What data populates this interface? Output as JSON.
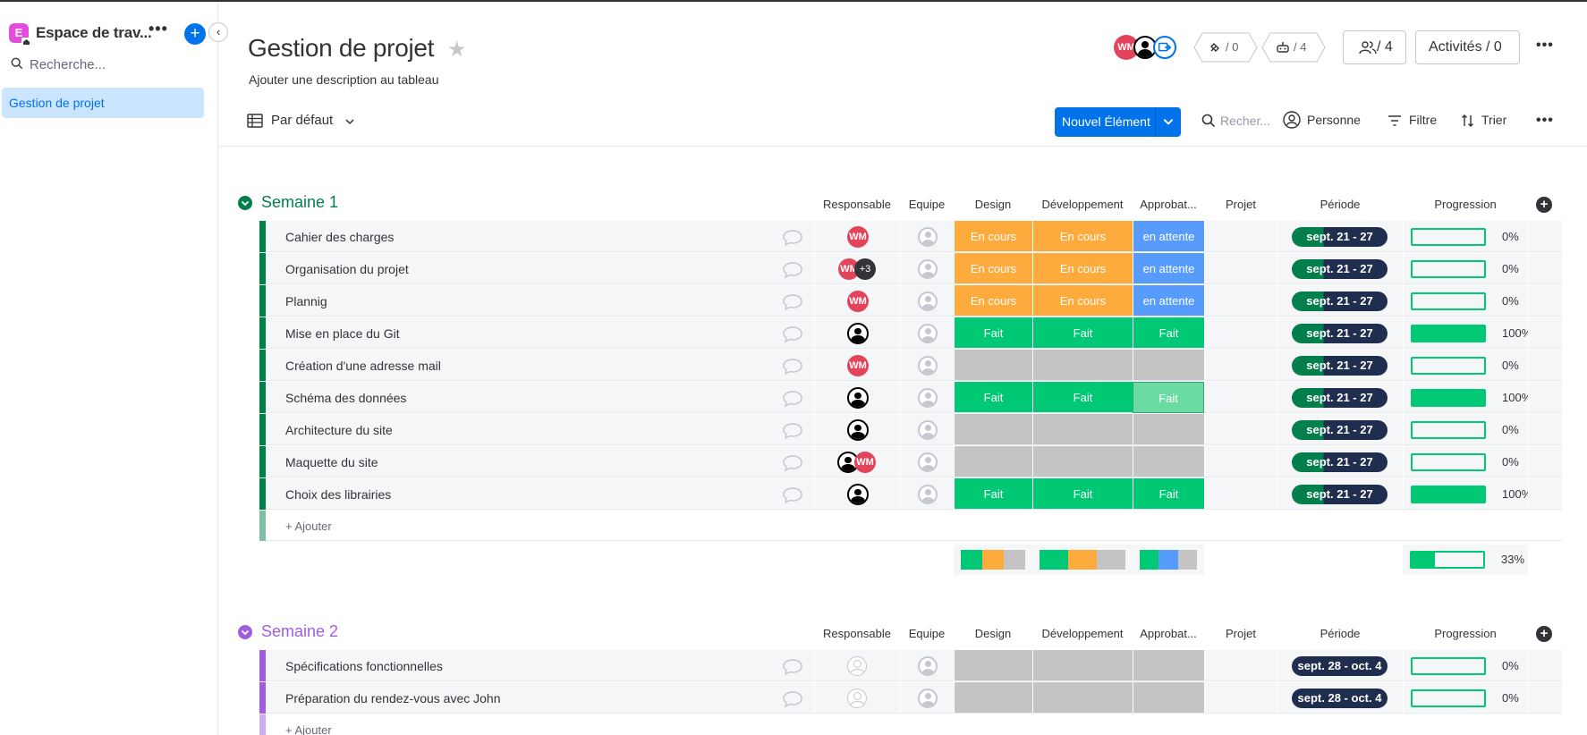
{
  "sidebar": {
    "workspace_initial": "E",
    "workspace_title": "Espace de trav...",
    "dots": "•••",
    "add": "+",
    "collapse": "‹",
    "search_placeholder": "Recherche...",
    "items": [
      {
        "label": "Gestion de projet",
        "active": true
      }
    ]
  },
  "header": {
    "title": "Gestion de projet",
    "description": "Ajouter une description au tableau",
    "avatars": [
      "WM"
    ],
    "integrations": "/ 0",
    "automations": "/ 4",
    "members": "/ 4",
    "activities": "Activités / 0",
    "more": "•••"
  },
  "toolbar": {
    "view": "Par défaut",
    "new_item": "Nouvel Élément",
    "search": "Recher...",
    "person": "Personne",
    "filter": "Filtre",
    "sort": "Trier",
    "more": "•••"
  },
  "columns": [
    "Responsable",
    "Equipe",
    "Design",
    "Développement",
    "Approbat...",
    "Projet",
    "Période",
    "Progression"
  ],
  "colors": {
    "green": "#00c875",
    "orange": "#fdab3d",
    "blue": "#579bfc",
    "grey": "#c4c4c4",
    "navy": "#1f2d4e",
    "group1": "#037f4c",
    "group2": "#a25ddc"
  },
  "groups": [
    {
      "name": "Semaine 1",
      "color": "#037f4c",
      "add_label": "+ Ajouter",
      "rows": [
        {
          "name": "Cahier des charges",
          "owner": "wm",
          "design": "En cours",
          "dev": "En cours",
          "approval": "en attente",
          "period": "sept. 21 - 27",
          "progress": 0,
          "progress_label": "0%"
        },
        {
          "name": "Organisation du projet",
          "owner": "wm+3",
          "design": "En cours",
          "dev": "En cours",
          "approval": "en attente",
          "period": "sept. 21 - 27",
          "progress": 0,
          "progress_label": "0%"
        },
        {
          "name": "Plannig",
          "owner": "wm",
          "design": "En cours",
          "dev": "En cours",
          "approval": "en attente",
          "period": "sept. 21 - 27",
          "progress": 0,
          "progress_label": "0%"
        },
        {
          "name": "Mise en place du Git",
          "owner": "user",
          "design": "Fait",
          "dev": "Fait",
          "approval": "Fait",
          "period": "sept. 21 - 27",
          "progress": 100,
          "progress_label": "100%"
        },
        {
          "name": "Création d'une adresse mail",
          "owner": "wm",
          "design": "",
          "dev": "",
          "approval": "",
          "period": "sept. 21 - 27",
          "progress": 0,
          "progress_label": "0%"
        },
        {
          "name": "Schéma des données",
          "owner": "user",
          "design": "Fait",
          "dev": "Fait",
          "approval": "Fait",
          "approval_light": true,
          "period": "sept. 21 - 27",
          "progress": 100,
          "progress_label": "100%"
        },
        {
          "name": "Architecture du site",
          "owner": "user",
          "design": "",
          "dev": "",
          "approval": "",
          "period": "sept. 21 - 27",
          "progress": 0,
          "progress_label": "0%"
        },
        {
          "name": "Maquette du site",
          "owner": "user+wm",
          "design": "",
          "dev": "",
          "approval": "",
          "period": "sept. 21 - 27",
          "progress": 0,
          "progress_label": "0%"
        },
        {
          "name": "Choix des librairies",
          "owner": "user",
          "design": "Fait",
          "dev": "Fait",
          "approval": "Fait",
          "period": "sept. 21 - 27",
          "progress": 100,
          "progress_label": "100%"
        }
      ],
      "summary": {
        "progress": 33,
        "progress_label": "33%"
      }
    },
    {
      "name": "Semaine 2",
      "color": "#a25ddc",
      "add_label": "+ Ajouter",
      "rows": [
        {
          "name": "Spécifications fonctionnelles",
          "owner": "empty",
          "design": "",
          "dev": "",
          "approval": "",
          "period": "sept. 28 - oct. 4",
          "progress": 0,
          "progress_label": "0%"
        },
        {
          "name": "Préparation du rendez-vous avec John",
          "owner": "empty",
          "design": "",
          "dev": "",
          "approval": "",
          "period": "sept. 28 - oct. 4",
          "progress": 0,
          "progress_label": "0%"
        }
      ]
    }
  ]
}
